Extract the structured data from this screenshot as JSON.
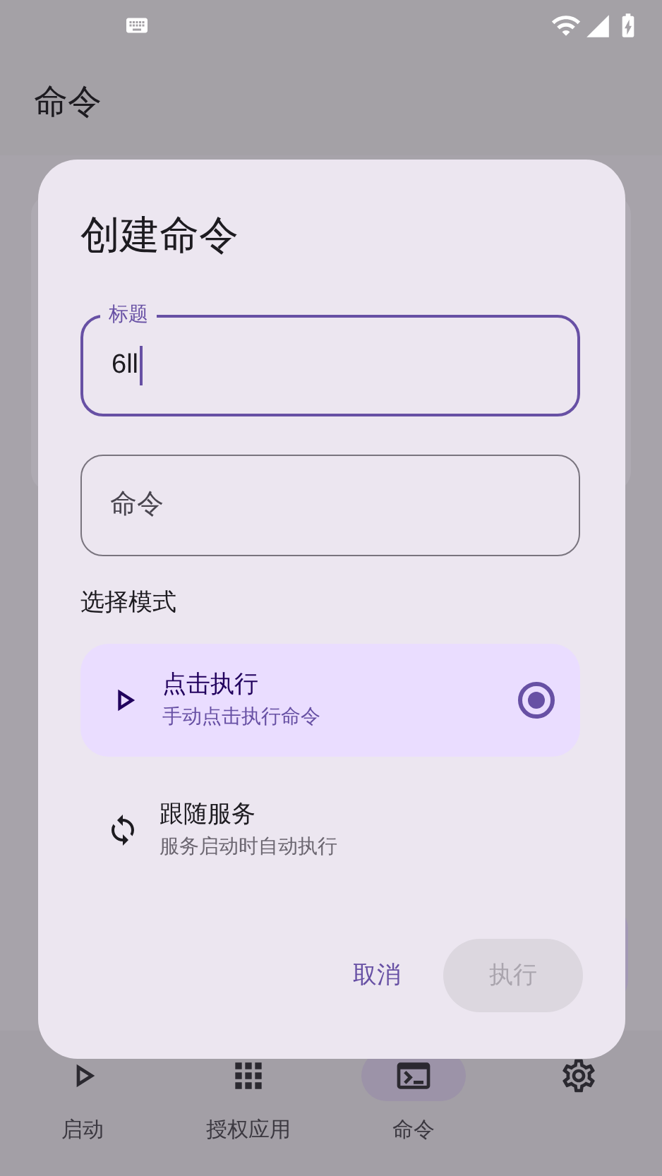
{
  "app_bar": {
    "title": "命令"
  },
  "dialog": {
    "title": "创建命令",
    "fields": [
      {
        "label": "标题",
        "value": "6ll",
        "focused": true
      },
      {
        "placeholder": "命令",
        "focused": false
      }
    ],
    "mode_label": "选择模式",
    "modes": [
      {
        "kind": "play",
        "title": "点击执行",
        "subtitle": "手动点击执行命令",
        "selected": true
      },
      {
        "kind": "sync",
        "title": "跟随服务",
        "subtitle": "服务启动时自动执行",
        "selected": false
      }
    ],
    "buttons": [
      {
        "label": "取消",
        "disabled": false
      },
      {
        "label": "执行",
        "disabled": true
      }
    ]
  },
  "nav": [
    {
      "kind": "play",
      "label": "启动",
      "selected": false
    },
    {
      "kind": "grid",
      "label": "授权应用",
      "selected": false
    },
    {
      "kind": "terminal",
      "label": "命令",
      "selected": true
    },
    {
      "kind": "settings",
      "selected": false
    }
  ]
}
